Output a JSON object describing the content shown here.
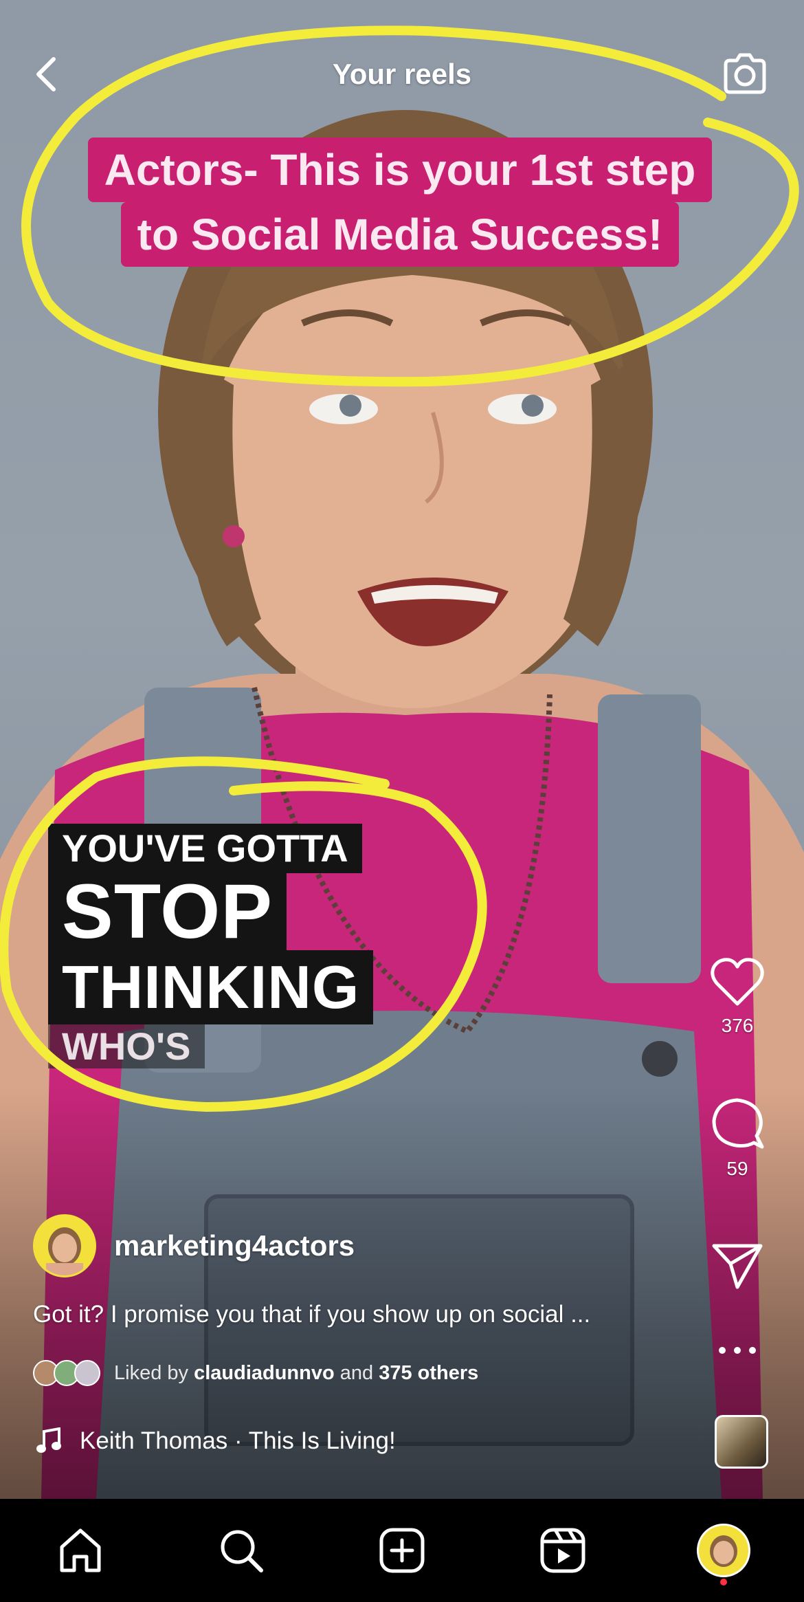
{
  "header": {
    "title": "Your reels"
  },
  "video": {
    "headline_lines": [
      "Actors- This is your 1st step",
      "to Social Media Success!"
    ],
    "hook_lines": [
      "YOU'VE GOTTA",
      "STOP",
      "THINKING",
      "WHO'S"
    ]
  },
  "actions": {
    "like_count": "376",
    "comment_count": "59"
  },
  "post": {
    "username": "marketing4actors",
    "caption": "Got it? I promise you that if you show up on social ...",
    "likes": {
      "prefix": "Liked by",
      "user": "claudiadunnvo",
      "middle": "and",
      "others": "375 others"
    },
    "audio": "Keith Thomas · This Is Living!"
  },
  "icons": {
    "back": "chevron-left-icon",
    "camera": "camera-icon",
    "like": "heart-icon",
    "comment": "comment-icon",
    "share": "send-icon",
    "more": "more-icon",
    "music": "music-note-icon",
    "home": "home-icon",
    "search": "search-icon",
    "create": "plus-square-icon",
    "reels": "reels-icon"
  },
  "colors": {
    "headline_bg": "#c81f70",
    "annotation": "#f4ec3a",
    "notification_dot": "#ff3040"
  }
}
